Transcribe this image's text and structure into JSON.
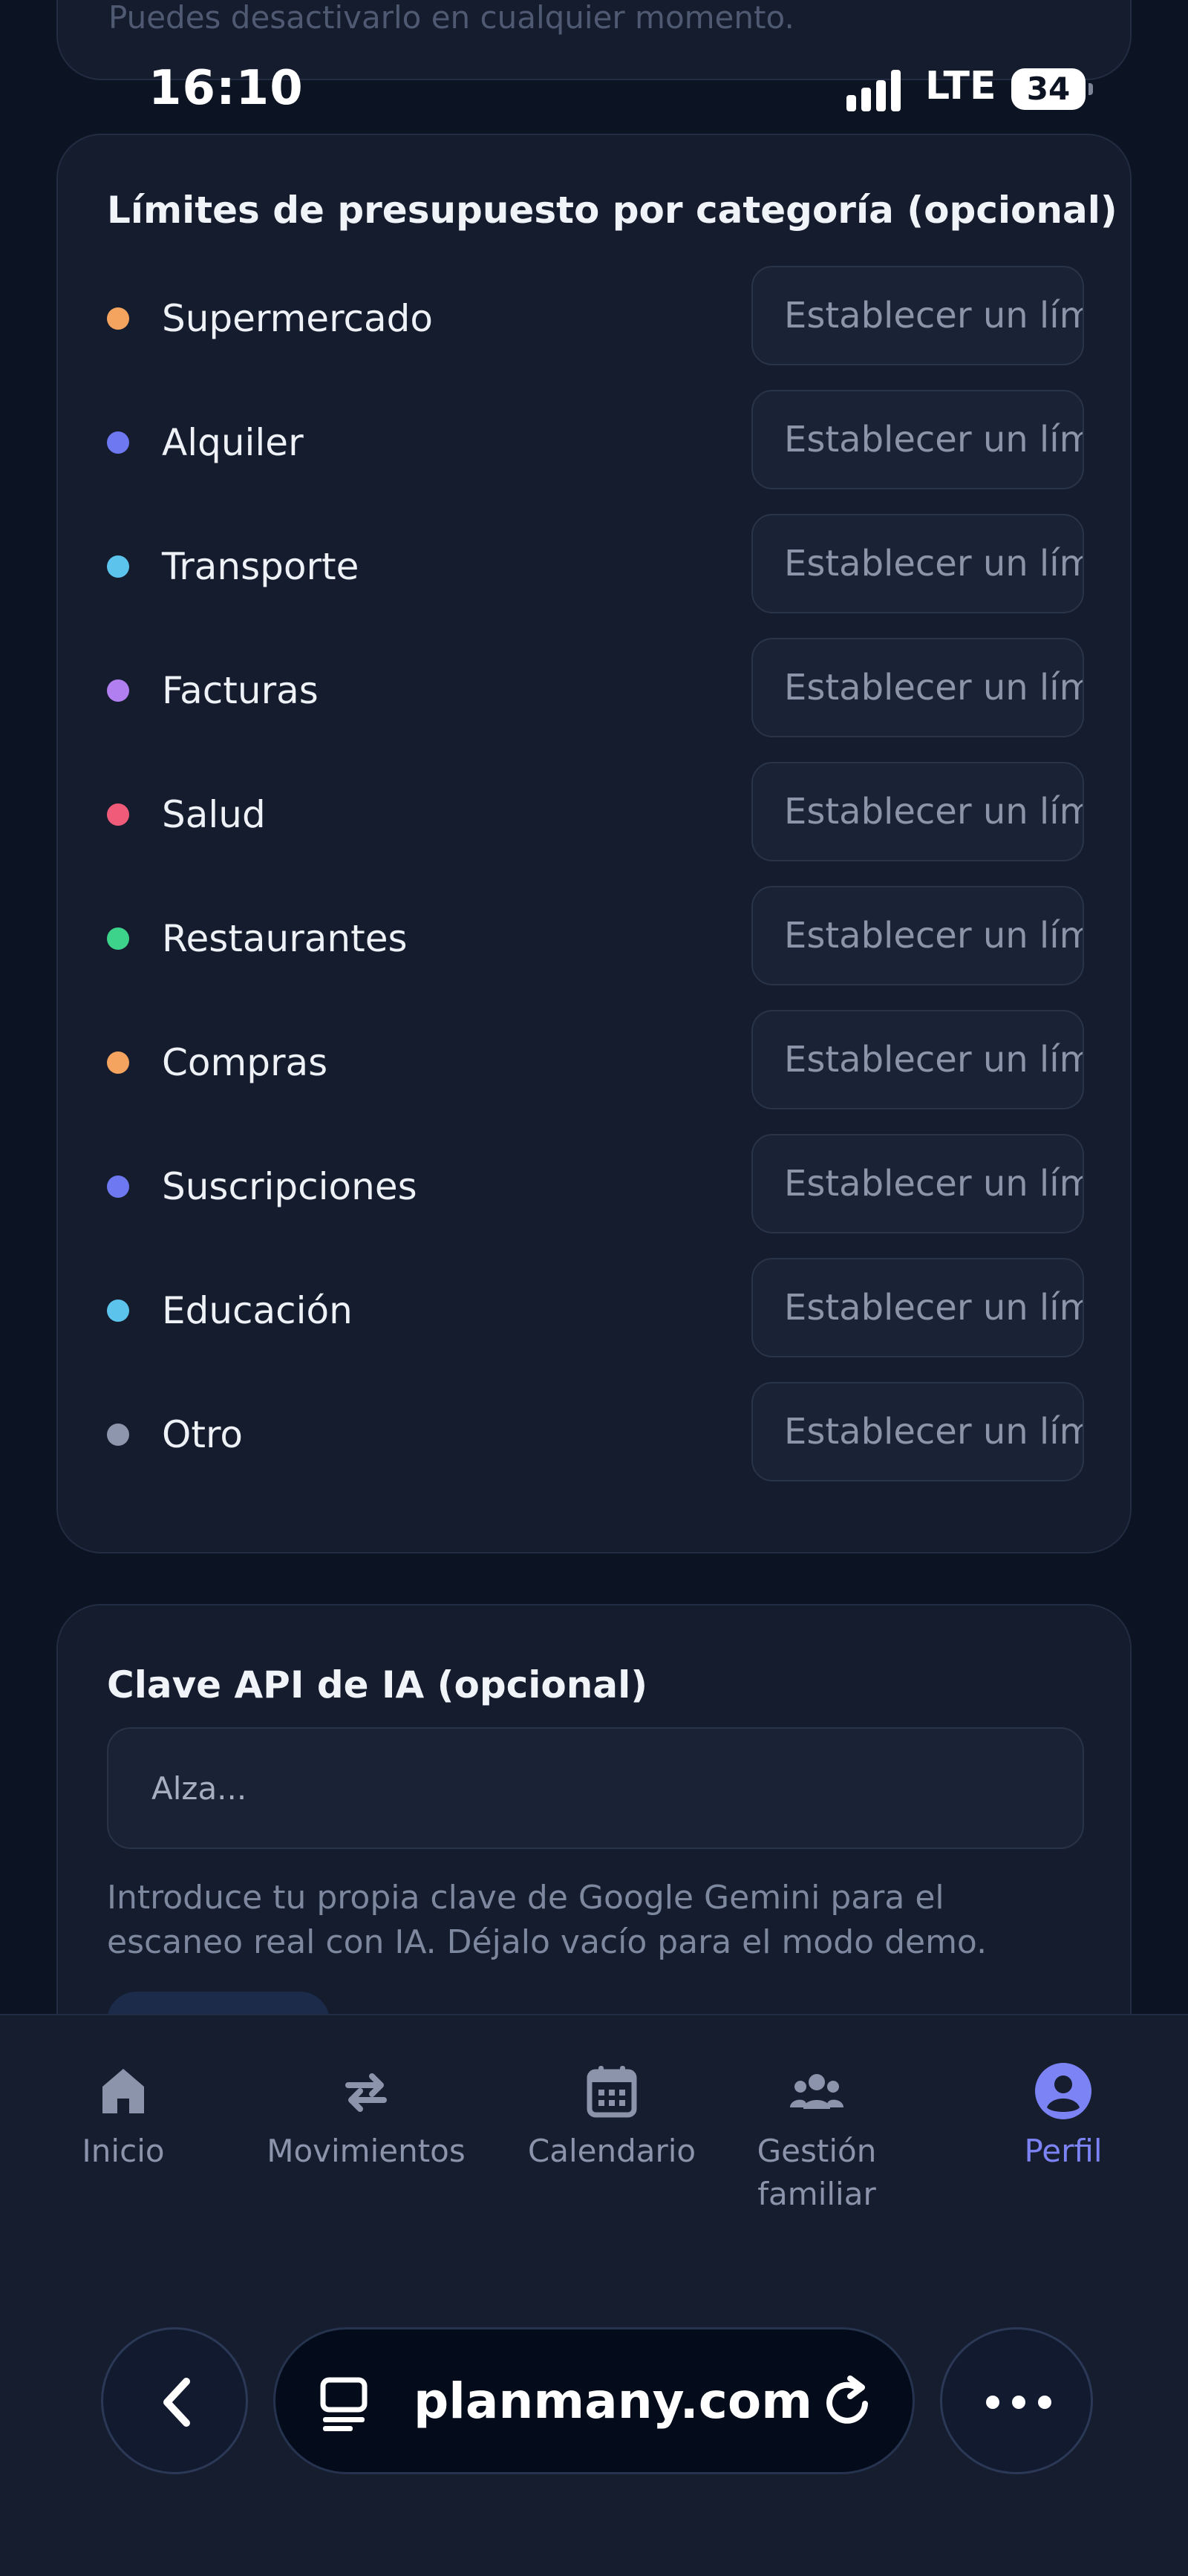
{
  "top_card": {
    "text": "Puedes desactivarlo en cualquier momento."
  },
  "status_bar": {
    "time": "16:10",
    "network": "LTE",
    "battery": "34"
  },
  "budget": {
    "title": "Límites de presupuesto por categoría (opcional)",
    "input_placeholder": "Establecer un límite",
    "categories": [
      {
        "label": "Supermercado",
        "color": "#f5a45f"
      },
      {
        "label": "Alquiler",
        "color": "#6e78f0"
      },
      {
        "label": "Transporte",
        "color": "#5cc3ec"
      },
      {
        "label": "Facturas",
        "color": "#b17ff0"
      },
      {
        "label": "Salud",
        "color": "#ef5b78"
      },
      {
        "label": "Restaurantes",
        "color": "#3ed38b"
      },
      {
        "label": "Compras",
        "color": "#f5a45f"
      },
      {
        "label": "Suscripciones",
        "color": "#6e78f0"
      },
      {
        "label": "Educación",
        "color": "#5cc3ec"
      },
      {
        "label": "Otro",
        "color": "#8e96ad"
      }
    ]
  },
  "api_key": {
    "title": "Clave API de IA (opcional)",
    "placeholder": "Alza...",
    "help": "Introduce tu propia clave de Google Gemini para el escaneo real con IA. Déjalo vacío para el modo demo."
  },
  "nav": {
    "items": [
      {
        "label": "Inicio",
        "icon": "home-icon"
      },
      {
        "label": "Movimientos",
        "icon": "arrows-exchange-icon"
      },
      {
        "label": "Calendario",
        "icon": "calendar-icon"
      },
      {
        "label": "Gestión familiar",
        "icon": "people-icon"
      },
      {
        "label": "Perfil",
        "icon": "user-circle-icon",
        "active": true
      }
    ],
    "active_color": "#7c83f5",
    "inactive_color": "#8b94ab"
  },
  "browser": {
    "url": "planmany.com",
    "back_icon": "chevron-left-icon",
    "page_icon": "tabs-icon",
    "reload_icon": "reload-icon",
    "more_icon": "more-icon"
  }
}
